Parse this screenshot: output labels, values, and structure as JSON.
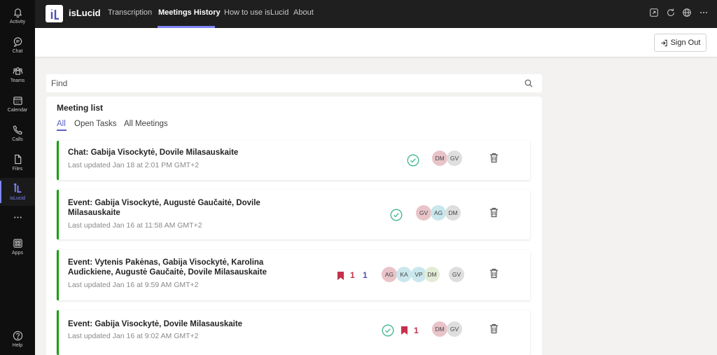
{
  "rail": {
    "items": [
      {
        "label": "Activity",
        "icon": "bell-icon"
      },
      {
        "label": "Chat",
        "icon": "chat-icon"
      },
      {
        "label": "Teams",
        "icon": "teams-icon"
      },
      {
        "label": "Calendar",
        "icon": "calendar-icon"
      },
      {
        "label": "Calls",
        "icon": "phone-icon"
      },
      {
        "label": "Files",
        "icon": "file-icon"
      },
      {
        "label": "isLucid",
        "icon": "islucid-icon",
        "active": true
      },
      {
        "label": "",
        "icon": "more-icon"
      },
      {
        "label": "Apps",
        "icon": "apps-icon"
      }
    ],
    "help_label": "Help"
  },
  "topbar": {
    "app_title": "isLucid",
    "tabs": [
      {
        "label": "Transcription"
      },
      {
        "label": "Meetings History",
        "active": true
      },
      {
        "label": "How to use isLucid"
      },
      {
        "label": "About"
      }
    ],
    "accent": "#7f85f5"
  },
  "header": {
    "signout_label": "Sign Out"
  },
  "search": {
    "placeholder": "Find"
  },
  "meeting_list": {
    "title": "Meeting list",
    "filters": [
      {
        "label": "All",
        "active": true
      },
      {
        "label": "Open Tasks"
      },
      {
        "label": "All Meetings"
      }
    ],
    "meetings": [
      {
        "title": "Chat: Gabija Visockytė, Dovile Milasauskaite",
        "updated": "Last updated Jan 18 at 2:01 PM GMT+2",
        "completed": true,
        "participants": [
          "DM",
          "GV"
        ]
      },
      {
        "title": "Event: Gabija Visockytė, Augustė Gaučaitė, Dovile Milasauskaite",
        "updated": "Last updated Jan 16 at 11:58 AM GMT+2",
        "completed": true,
        "participants": [
          "GV",
          "AG",
          "DM"
        ]
      },
      {
        "title": "Event: Vytenis Pakėnas, Gabija Visockytė, Karolina Audickiene, Augustė Gaučaitė, Dovile Milasauskaite",
        "updated": "Last updated Jan 16 at 9:59 AM GMT+2",
        "bookmarks": "1",
        "tasks": "1",
        "participants": [
          "AG",
          "KA",
          "VP",
          "DM",
          "GV"
        ]
      },
      {
        "title": "Event: Gabija Visockytė, Dovile Milasauskaite",
        "updated": "Last updated Jan 16 at 9:02 AM GMT+2",
        "completed": true,
        "bookmarks": "1",
        "participants": [
          "DM",
          "GV"
        ]
      }
    ],
    "colors": {
      "card_border": "#13a10e",
      "check": "#3fb68b",
      "bookmark": "#c4314b",
      "task_count": "#4f52b2"
    }
  },
  "avatar_colors": {
    "DM": "#e8c4c9",
    "GV": "#dedede",
    "AG": "#e8c4c9",
    "KA": "#c9e7ec",
    "VP": "#c9e7ec",
    "DM2": "#e3ecd6"
  }
}
